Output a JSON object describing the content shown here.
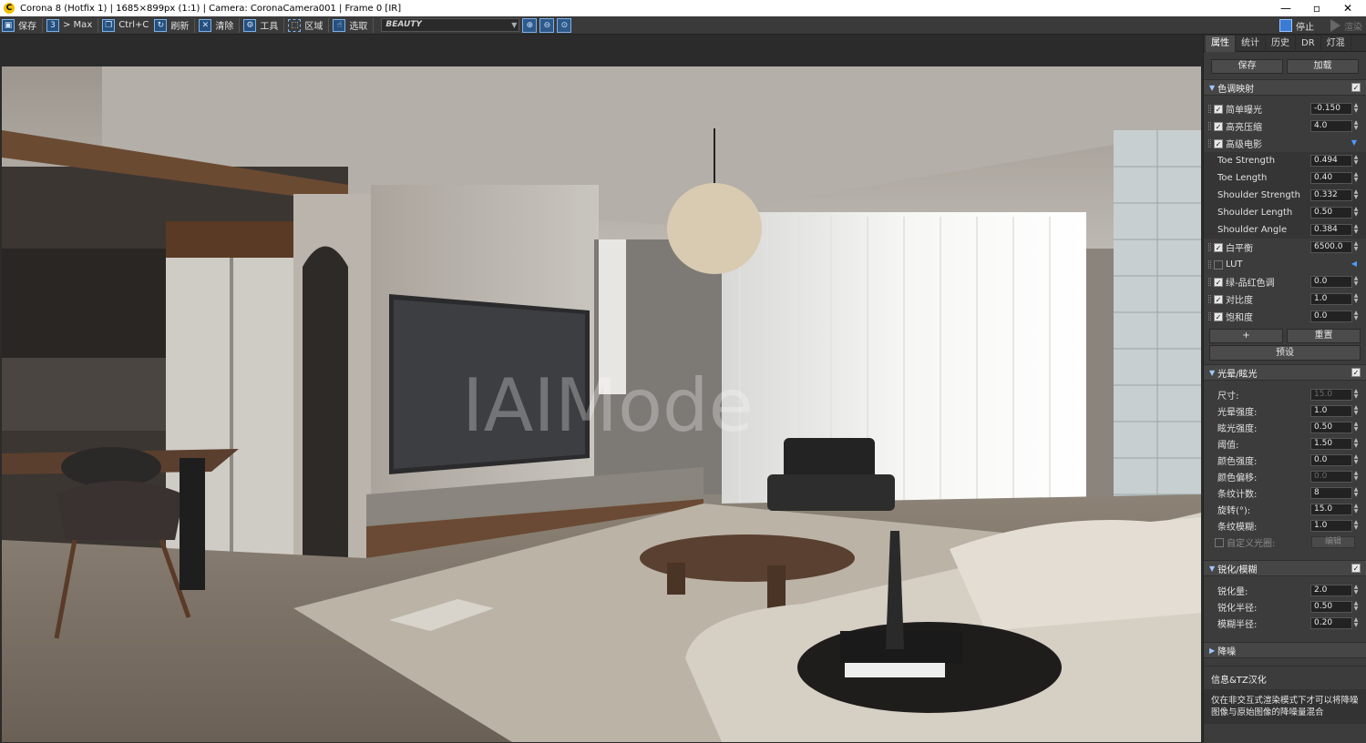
{
  "window": {
    "title": "Corona 8 (Hotfix 1) | 1685×899px (1:1) | Camera: CoronaCamera001 | Frame 0 [IR]",
    "app_icon": "C",
    "controls": {
      "minimize": "—",
      "maximize": "▫",
      "close": "✕"
    }
  },
  "toolbar": {
    "save_label": "保存",
    "to_max_label": "> Max",
    "copy_label": "Ctrl+C",
    "refresh_label": "刷新",
    "clear_label": "清除",
    "tools_label": "工具",
    "region_label": "区域",
    "pick_label": "选取",
    "pass_selected": "BEAUTY",
    "stop_label": "停止",
    "render_label": "渲染"
  },
  "viewport": {
    "watermark": "IAIMode"
  },
  "panel": {
    "tabs": [
      "属性",
      "统计",
      "历史",
      "DR",
      "灯混"
    ],
    "save_label": "保存",
    "load_label": "加载",
    "tone_mapping": {
      "header": "色调映射",
      "rows": [
        {
          "label": "简单曝光",
          "value": "-0.150",
          "checked": true
        },
        {
          "label": "高亮压缩",
          "value": "4.0",
          "checked": true
        },
        {
          "label": "高级电影",
          "checked": true
        }
      ],
      "filmic": [
        {
          "label": "Toe Strength",
          "value": "0.494"
        },
        {
          "label": "Toe Length",
          "value": "0.40"
        },
        {
          "label": "Shoulder Strength",
          "value": "0.332"
        },
        {
          "label": "Shoulder Length",
          "value": "0.50"
        },
        {
          "label": "Shoulder Angle",
          "value": "0.384"
        }
      ],
      "rows2": [
        {
          "label": "白平衡",
          "value": "6500.0",
          "checked": true
        },
        {
          "label": "LUT",
          "checked": false
        },
        {
          "label": "绿-品红色调",
          "value": "0.0",
          "checked": true
        },
        {
          "label": "对比度",
          "value": "1.0",
          "checked": true
        },
        {
          "label": "饱和度",
          "value": "0.0",
          "checked": true
        }
      ],
      "add_label": "+",
      "reset_label": "重置",
      "preset_label": "预设"
    },
    "bloom_glare": {
      "header": "光晕/眩光",
      "rows": [
        {
          "label": "尺寸:",
          "value": "15.0",
          "dim": true
        },
        {
          "label": "光晕强度:",
          "value": "1.0"
        },
        {
          "label": "眩光强度:",
          "value": "0.50"
        },
        {
          "label": "阈值:",
          "value": "1.50"
        },
        {
          "label": "颜色强度:",
          "value": "0.0"
        },
        {
          "label": "颜色偏移:",
          "value": "0.0",
          "dim": true
        },
        {
          "label": "条纹计数:",
          "value": "8"
        },
        {
          "label": "旋转(°):",
          "value": "15.0"
        },
        {
          "label": "条纹模糊:",
          "value": "1.0"
        }
      ],
      "custom_label": "自定义光圈:",
      "edit_label": "编辑"
    },
    "sharpen_blur": {
      "header": "锐化/模糊",
      "rows": [
        {
          "label": "锐化量:",
          "value": "2.0"
        },
        {
          "label": "锐化半径:",
          "value": "0.50"
        },
        {
          "label": "模糊半径:",
          "value": "0.20"
        }
      ]
    },
    "denoise": {
      "header": "降噪"
    },
    "info": {
      "title": "信息&TZ汉化",
      "text": "仅在非交互式渲染模式下才可以将降噪图像与原始图像的降噪量混合"
    }
  }
}
